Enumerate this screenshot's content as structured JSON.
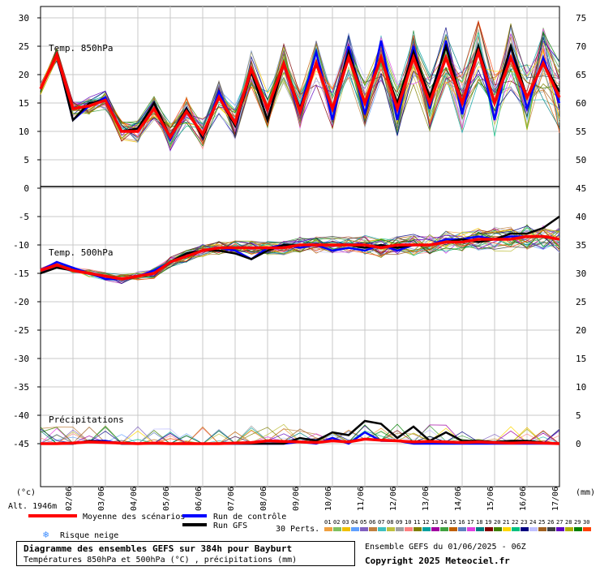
{
  "chart_data": {
    "type": "line",
    "dates": [
      "02/06",
      "03/06",
      "04/06",
      "05/06",
      "06/06",
      "07/06",
      "08/06",
      "09/06",
      "10/06",
      "11/06",
      "12/06",
      "13/06",
      "14/06",
      "15/06",
      "16/06",
      "17/06"
    ],
    "left_axis_ticks": [
      30,
      25,
      20,
      15,
      10,
      5,
      0,
      -5,
      -10,
      -15,
      -20,
      -25,
      -30,
      -35,
      -40,
      -45
    ],
    "right_axis_ticks_top": [
      75,
      70,
      65,
      60,
      55,
      50
    ],
    "right_axis_ticks_bottom": [
      45,
      40,
      35,
      30,
      25,
      20,
      15,
      10,
      5,
      0
    ],
    "left_unit": "(°c)",
    "right_unit": "(mm)",
    "altitude": "Alt. 1946m",
    "panel_labels": {
      "t850": "Temp. 850hPa",
      "t500": "Temp. 500hPa",
      "precip": "Précipitations"
    },
    "xrange_days": [
      0,
      16
    ],
    "temp850_ylim": [
      0,
      30
    ],
    "temp500_ylim": [
      -45,
      -2
    ],
    "precip_ylim": [
      0,
      45
    ],
    "series": [
      {
        "name": "Moyenne des scénarios",
        "color": "#ff0000",
        "t850": [
          17.5,
          23.5,
          14,
          14.5,
          15.5,
          10,
          10,
          14,
          9,
          13.5,
          9.5,
          16,
          11.5,
          21,
          14,
          22,
          13.5,
          22,
          14,
          23,
          15,
          23,
          14,
          23,
          15,
          23,
          15,
          24,
          15,
          23,
          16,
          22,
          16
        ],
        "t500": [
          -14.5,
          -13.5,
          -14.5,
          -15,
          -15.5,
          -16,
          -15.5,
          -15,
          -13,
          -12,
          -11,
          -10.5,
          -10.5,
          -10.5,
          -10.5,
          -10.5,
          -10,
          -10,
          -10,
          -10,
          -10,
          -10.5,
          -10,
          -10,
          -10,
          -9.5,
          -9.5,
          -9,
          -9,
          -9,
          -8.5,
          -8.5,
          -9
        ],
        "precip": [
          0,
          0,
          0.1,
          0.3,
          0.2,
          0.1,
          0,
          0.1,
          0,
          0,
          0,
          0,
          0.1,
          0.2,
          0.5,
          0.4,
          0.3,
          0.2,
          0.5,
          0.3,
          0.8,
          0.6,
          0.5,
          0.3,
          0.4,
          0.3,
          0.2,
          0.3,
          0.2,
          0.1,
          0.2,
          0.1,
          0
        ]
      },
      {
        "name": "Run de contrôle",
        "color": "#0000ff",
        "t850": [
          17.5,
          23.5,
          12,
          14.5,
          16,
          10,
          10.5,
          15,
          8.5,
          14,
          9,
          17,
          11,
          20.5,
          12,
          22,
          14,
          24,
          12,
          25,
          13,
          26,
          12,
          25,
          14,
          26,
          13,
          25,
          12,
          25,
          14,
          23,
          15
        ],
        "t500": [
          -14.5,
          -13,
          -14,
          -15,
          -16,
          -16,
          -15.5,
          -14.5,
          -13,
          -11.5,
          -11,
          -10.5,
          -11,
          -12.5,
          -10.5,
          -10,
          -10.5,
          -10,
          -11,
          -10.5,
          -11,
          -10,
          -11,
          -10,
          -10,
          -9,
          -9,
          -8.5,
          -9,
          -8.5,
          -8.5,
          -8.5,
          -9
        ],
        "precip": [
          0,
          0,
          0,
          0.5,
          0.5,
          0,
          0,
          0.1,
          0,
          0,
          0,
          0,
          0,
          0,
          0,
          0,
          0.3,
          0,
          1,
          0,
          2,
          0.5,
          0.5,
          0,
          0,
          0,
          0,
          0,
          0,
          0,
          0,
          0,
          0
        ]
      },
      {
        "name": "Run GFS",
        "color": "#000000",
        "t850": [
          17.5,
          23.5,
          12,
          15,
          15.5,
          10,
          10.5,
          15,
          9,
          14,
          9,
          16,
          11,
          20.5,
          12,
          22,
          14,
          22,
          14,
          24,
          15,
          23,
          15,
          24,
          16,
          25,
          15,
          25,
          15,
          25,
          16,
          22,
          17
        ],
        "t500": [
          -15,
          -14,
          -14.5,
          -15,
          -15.5,
          -16,
          -15.5,
          -15,
          -13,
          -11.5,
          -11,
          -11,
          -11.5,
          -12.5,
          -11,
          -10,
          -10,
          -10,
          -10,
          -10,
          -10.5,
          -10,
          -10.5,
          -10,
          -10,
          -9.5,
          -9,
          -9.5,
          -9,
          -8,
          -8,
          -7,
          -5
        ],
        "precip": [
          0,
          0,
          0,
          0.5,
          0.3,
          0,
          0,
          0,
          0,
          0,
          0,
          0,
          0,
          0,
          0,
          0,
          1,
          0.5,
          2,
          1.5,
          4,
          3.5,
          1,
          3,
          0.5,
          2,
          0.5,
          0.5,
          0.3,
          0.5,
          0.5,
          0.2,
          0
        ]
      }
    ],
    "perturbation_count": 30,
    "perturbation_labels": [
      "01",
      "02",
      "03",
      "04",
      "05",
      "06",
      "07",
      "08",
      "09",
      "10",
      "11",
      "12",
      "13",
      "14",
      "15",
      "16",
      "17",
      "18",
      "19",
      "20",
      "21",
      "22",
      "23",
      "24",
      "25",
      "26",
      "27",
      "28",
      "29",
      "30"
    ],
    "perturbation_colors": [
      "#f0a040",
      "#80c060",
      "#f0c000",
      "#60a0ff",
      "#8060c0",
      "#c08040",
      "#40c0c0",
      "#c0c040",
      "#a0a0a0",
      "#ff8080",
      "#808000",
      "#00a0a0",
      "#a000a0",
      "#40a040",
      "#c06000",
      "#6080c0",
      "#e040e0",
      "#008080",
      "#800000",
      "#408000",
      "#ffd700",
      "#00c080",
      "#000080",
      "#c0c0ff",
      "#a06020",
      "#404040",
      "#6000c0",
      "#b0b000",
      "#008000",
      "#ff4000"
    ],
    "perturbation_legend": "30 Perts.",
    "grid": true
  },
  "legend": {
    "mean_label": "Moyenne des scénarios",
    "control_label": "Run de contrôle",
    "gfs_label": "Run GFS",
    "snow_label": "Risque neige",
    "mean_color": "#ff0000",
    "control_color": "#0000ff",
    "gfs_color": "#000000",
    "snow_icon": "snowflake-icon",
    "snow_icon_glyph": "❄",
    "snow_color": "#3c8cff"
  },
  "footer": {
    "title": "Diagramme des ensembles GEFS sur 384h pour Bayburt",
    "subtitle": "Températures 850hPa et 500hPa (°C) , précipitations (mm)",
    "run": "Ensemble GEFS du 01/06/2025 - 06Z",
    "copyright": "Copyright 2025 Meteociel.fr"
  }
}
